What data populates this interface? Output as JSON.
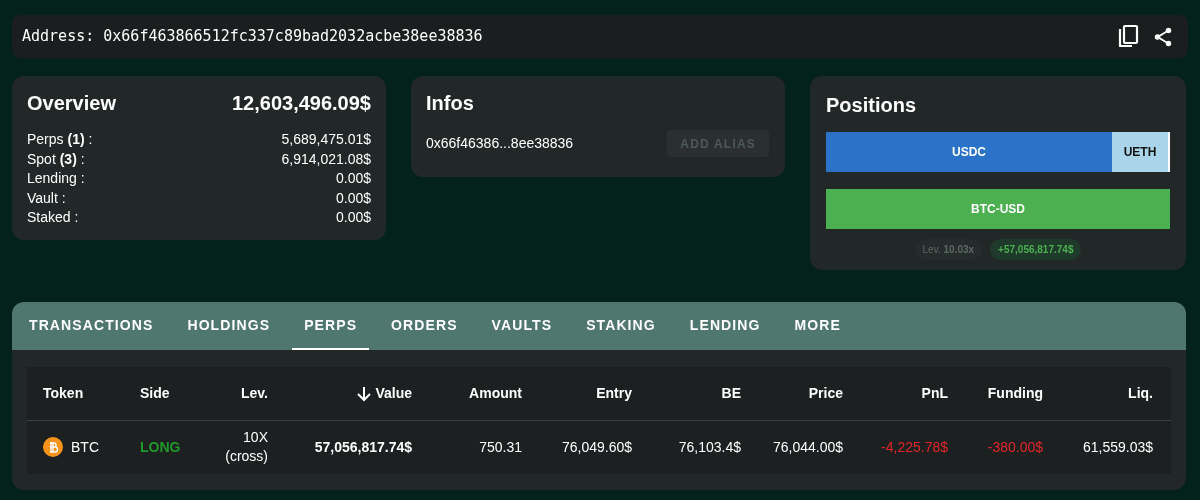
{
  "address_bar": {
    "label": "Address:",
    "address": "0x66f463866512fc337c89bad2032acbe38ee38836"
  },
  "overview": {
    "title": "Overview",
    "total": "12,603,496.09$",
    "rows": [
      {
        "label": "Perps **(1)** :",
        "value": "5,689,475.01$"
      },
      {
        "label": "Spot **(3)** :",
        "value": "6,914,021.08$"
      },
      {
        "label": "Lending :",
        "value": "0.00$"
      },
      {
        "label": "Vault :",
        "value": "0.00$"
      },
      {
        "label": "Staked :",
        "value": "0.00$"
      }
    ]
  },
  "infos": {
    "title": "Infos",
    "short_address": "0x66f46386...8ee38836",
    "alias_button": {
      "label": "ADD ALIAS",
      "disabled": true
    }
  },
  "positions": {
    "title": "Positions",
    "bars": [
      {
        "segments": [
          {
            "label": "USDC",
            "color": "#2a73c9"
          },
          {
            "label": "UETH",
            "color": "#a9d4ea"
          }
        ]
      },
      {
        "segments": [
          {
            "label": "BTC-USD",
            "color": "#4caf50"
          }
        ]
      }
    ],
    "leverage": {
      "label": "Lev.",
      "value": "10.03x"
    },
    "pnl": "+57,056,817.74$"
  },
  "tabs": [
    {
      "label": "TRANSACTIONS",
      "selected": false
    },
    {
      "label": "HOLDINGS",
      "selected": false
    },
    {
      "label": "PERPS",
      "selected": true
    },
    {
      "label": "ORDERS",
      "selected": false
    },
    {
      "label": "VAULTS",
      "selected": false
    },
    {
      "label": "STAKING",
      "selected": false
    },
    {
      "label": "LENDING",
      "selected": false
    },
    {
      "label": "MORE",
      "selected": false
    }
  ],
  "table": {
    "columns": [
      {
        "label": "Token",
        "sorted": false
      },
      {
        "label": "Side",
        "sorted": false
      },
      {
        "label": "Lev.",
        "sorted": false
      },
      {
        "label": "Value",
        "sorted": true
      },
      {
        "label": "Amount",
        "sorted": false
      },
      {
        "label": "Entry",
        "sorted": false
      },
      {
        "label": "BE",
        "sorted": false
      },
      {
        "label": "Price",
        "sorted": false
      },
      {
        "label": "PnL",
        "sorted": false
      },
      {
        "label": "Funding",
        "sorted": false
      },
      {
        "label": "Liq.",
        "sorted": false
      }
    ],
    "rows": [
      {
        "token": "BTC",
        "side": "LONG",
        "lev": "10X",
        "lev_mode": "(cross)",
        "value": "57,056,817.74$",
        "amount": "750.31",
        "entry": "76,049.60$",
        "be": "76,103.4$",
        "price": "76,044.00$",
        "pnl": "-4,225.78$",
        "pnl_negative": true,
        "funding": "-380.00$",
        "funding_negative": true,
        "liq": "61,559.03$"
      }
    ]
  }
}
